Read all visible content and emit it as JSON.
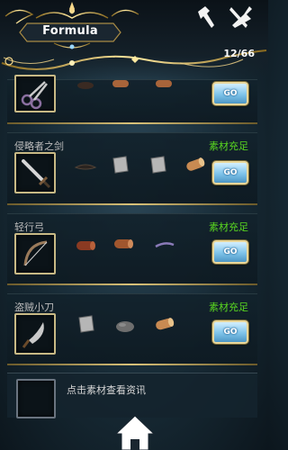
{
  "header": {
    "title": "Formula",
    "counter": "12/66",
    "icons": [
      "hammer-icon",
      "fork-knife-icon"
    ]
  },
  "recipes": [
    {
      "name": "",
      "status": "",
      "item_icon": "scissors-icon",
      "materials": [
        "leather-icon",
        "wood-log-icon",
        "wood-log-icon"
      ],
      "go_label": "GO"
    },
    {
      "name": "侵略者之剑",
      "status": "素材充足",
      "item_icon": "sword-icon",
      "materials": [
        "leather-strap-icon",
        "iron-plate-icon",
        "iron-plate-icon",
        "wood-log-icon"
      ],
      "go_label": "GO"
    },
    {
      "name": "轻行弓",
      "status": "素材充足",
      "item_icon": "bow-icon",
      "materials": [
        "wood-log-icon",
        "wood-log-icon",
        "string-icon"
      ],
      "go_label": "GO"
    },
    {
      "name": "盗贼小刀",
      "status": "素材充足",
      "item_icon": "dagger-icon",
      "materials": [
        "iron-plate-icon",
        "stone-icon",
        "wood-log-icon"
      ],
      "go_label": "GO"
    }
  ],
  "info_panel": {
    "text": "点击素材查看资讯"
  },
  "footer": {
    "icon": "home-icon"
  },
  "colors": {
    "accent_gold": "#d9c27a",
    "status_green": "#59d820",
    "go_blue": "#7fc4ea"
  }
}
